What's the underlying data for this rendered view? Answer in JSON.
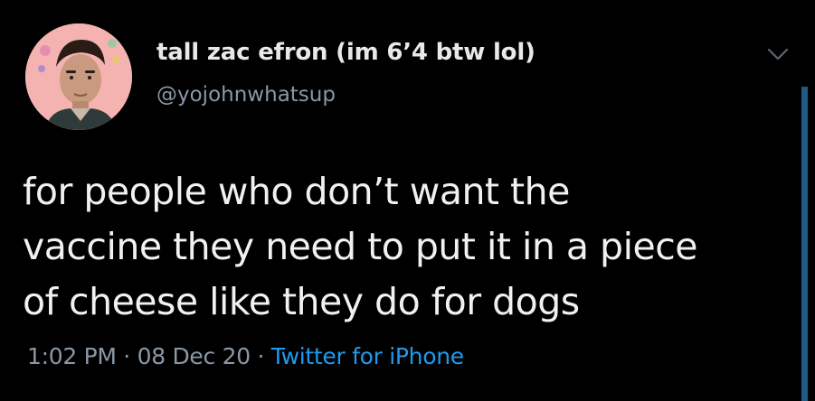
{
  "user": {
    "display_name": "tall zac efron (im 6’4 btw lol)",
    "handle": "@yojohnwhatsup",
    "avatar": "profile-photo"
  },
  "tweet": {
    "text_lines": [
      "for people who don’t want the",
      "vaccine they need to put it in a piece",
      "of cheese like they do for dogs"
    ]
  },
  "meta": {
    "time": "1:02 PM",
    "separator": "·",
    "date": "08 Dec 20",
    "source": "Twitter for iPhone"
  },
  "icons": {
    "menu": "chevron-down-icon"
  },
  "colors": {
    "background": "#000000",
    "text": "#f1f1f1",
    "secondary": "#8b98a5",
    "link": "#1d9bf0",
    "avatar_bg": "#f4b3b1"
  }
}
